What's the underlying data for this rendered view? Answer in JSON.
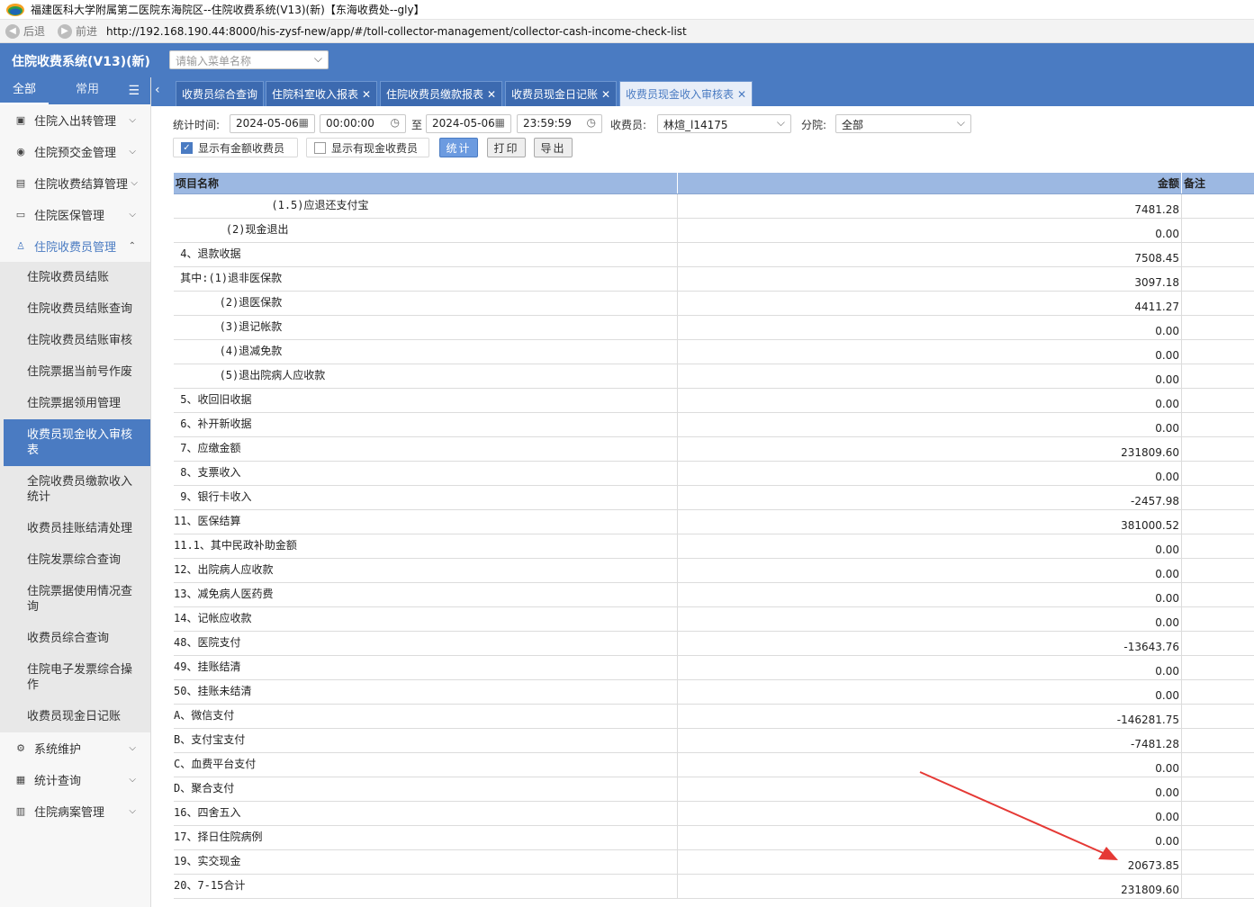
{
  "window": {
    "title": "福建医科大学附属第二医院东海院区--住院收费系统(V13)(新)【东海收费处--gly】"
  },
  "browser": {
    "back_label": "后退",
    "forward_label": "前进",
    "url": "http://192.168.190.44:8000/his-zysf-new/app/#/toll-collector-management/collector-cash-income-check-list"
  },
  "header": {
    "system_name": "住院收费系统(V13)(新)",
    "menu_search_placeholder": "请输入菜单名称"
  },
  "sidebar": {
    "tabs": [
      "全部",
      "常用"
    ],
    "groups_top": [
      {
        "label": "住院入出转管理",
        "icon": "calendar-icon"
      },
      {
        "label": "住院预交金管理",
        "icon": "coin-icon"
      },
      {
        "label": "住院收费结算管理",
        "icon": "invoice-icon"
      },
      {
        "label": "住院医保管理",
        "icon": "wallet-icon"
      },
      {
        "label": "住院收费员管理",
        "icon": "users-icon"
      }
    ],
    "submenu": [
      "住院收费员结账",
      "住院收费员结账查询",
      "住院收费员结账审核",
      "住院票据当前号作废",
      "住院票据领用管理",
      "收费员现金收入审核表",
      "全院收费员缴款收入统计",
      "收费员挂账结清处理",
      "住院发票综合查询",
      "住院票据使用情况查询",
      "收费员综合查询",
      "住院电子发票综合操作",
      "收费员现金日记账"
    ],
    "groups_bottom": [
      {
        "label": "系统维护",
        "icon": "gear-icon"
      },
      {
        "label": "统计查询",
        "icon": "chart-icon"
      },
      {
        "label": "住院病案管理",
        "icon": "record-icon"
      }
    ]
  },
  "tabs": [
    {
      "label": "收费员综合查询",
      "closable": false
    },
    {
      "label": "住院科室收入报表",
      "closable": true
    },
    {
      "label": "住院收费员缴款报表",
      "closable": true
    },
    {
      "label": "收费员现金日记账",
      "closable": true
    },
    {
      "label": "收费员现金收入审核表",
      "closable": true
    }
  ],
  "filters": {
    "stat_time_label": "统计时间:",
    "start_date": "2024-05-06",
    "start_time": "00:00:00",
    "to_label": "至",
    "end_date": "2024-05-06",
    "end_time": "23:59:59",
    "collector_label": "收费员:",
    "collector_value": "林煊_l14175",
    "branch_label": "分院:",
    "branch_value": "全部",
    "show_amount_label": "显示有金额收费员",
    "show_amount_checked": true,
    "show_cash_label": "显示有现金收费员",
    "show_cash_checked": false,
    "stat_button": "统计",
    "print_button": "打印",
    "export_button": "导出"
  },
  "table": {
    "headers": {
      "name": "项目名称",
      "amount": "金额",
      "remark": "备注"
    },
    "rows": [
      {
        "name": "               (1.5)应退还支付宝",
        "amount": "7481.28"
      },
      {
        "name": "        (2)现金退出",
        "amount": "0.00"
      },
      {
        "name": " 4、退款收据",
        "amount": "7508.45"
      },
      {
        "name": " 其中:(1)退非医保款",
        "amount": "3097.18"
      },
      {
        "name": "       (2)退医保款",
        "amount": "4411.27"
      },
      {
        "name": "       (3)退记帐款",
        "amount": "0.00"
      },
      {
        "name": "       (4)退减免款",
        "amount": "0.00"
      },
      {
        "name": "       (5)退出院病人应收款",
        "amount": "0.00"
      },
      {
        "name": " 5、收回旧收据",
        "amount": "0.00"
      },
      {
        "name": " 6、补开新收据",
        "amount": "0.00"
      },
      {
        "name": " 7、应缴金额",
        "amount": "231809.60"
      },
      {
        "name": " 8、支票收入",
        "amount": "0.00"
      },
      {
        "name": " 9、银行卡收入",
        "amount": "-2457.98"
      },
      {
        "name": "11、医保结算",
        "amount": "381000.52"
      },
      {
        "name": "11.1、其中民政补助金额",
        "amount": "0.00"
      },
      {
        "name": "12、出院病人应收款",
        "amount": "0.00"
      },
      {
        "name": "13、减免病人医药费",
        "amount": "0.00"
      },
      {
        "name": "14、记帐应收款",
        "amount": "0.00"
      },
      {
        "name": "48、医院支付",
        "amount": "-13643.76"
      },
      {
        "name": "49、挂账结清",
        "amount": "0.00"
      },
      {
        "name": "50、挂账未结清",
        "amount": "0.00"
      },
      {
        "name": "A、微信支付",
        "amount": "-146281.75"
      },
      {
        "name": "B、支付宝支付",
        "amount": "-7481.28"
      },
      {
        "name": "C、血费平台支付",
        "amount": "0.00"
      },
      {
        "name": "D、聚合支付",
        "amount": "0.00"
      },
      {
        "name": "16、四舍五入",
        "amount": "0.00"
      },
      {
        "name": "17、择日住院病例",
        "amount": "0.00"
      },
      {
        "name": "19、实交现金",
        "amount": "20673.85"
      },
      {
        "name": "20、7-15合计",
        "amount": "231809.60"
      }
    ]
  },
  "colors": {
    "brand": "#4a7bc2",
    "header_row": "#9cb8e2",
    "annotation_arrow": "#e53935"
  }
}
